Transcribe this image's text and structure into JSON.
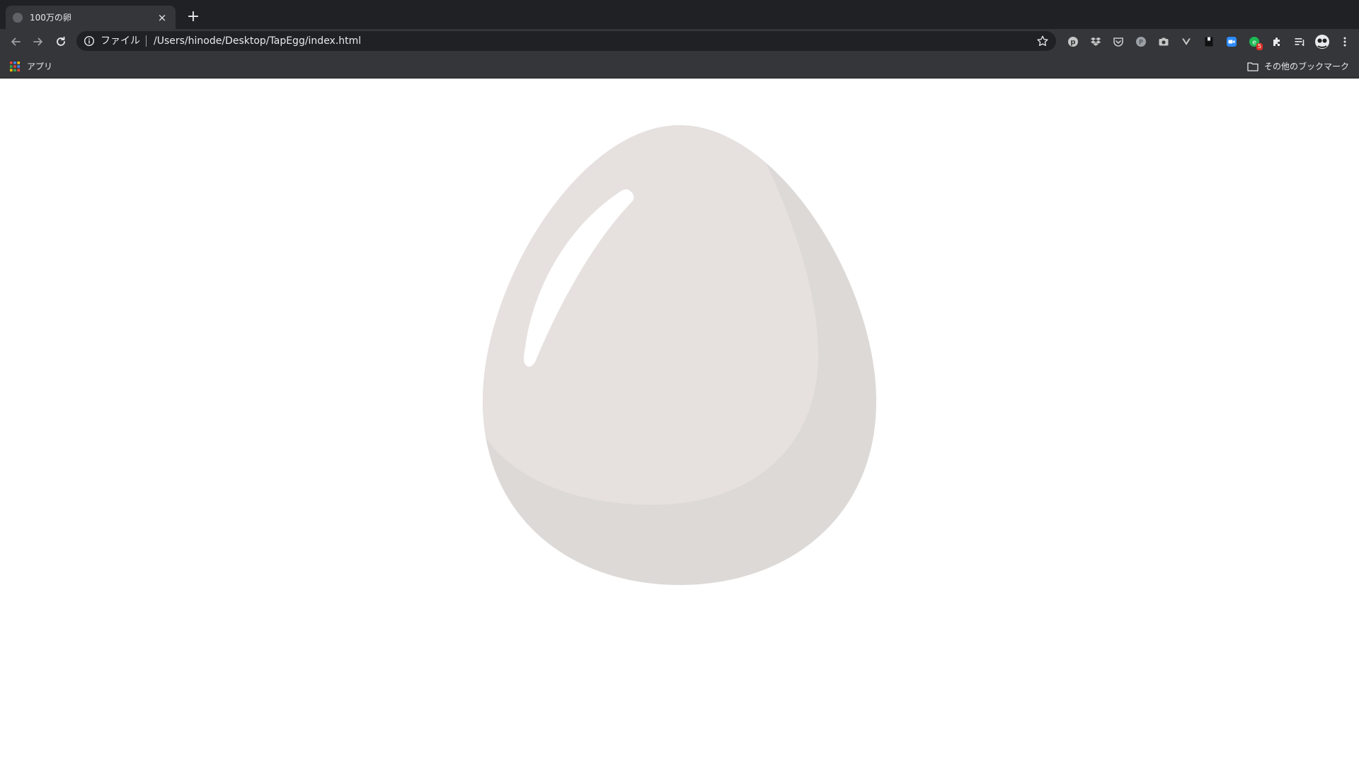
{
  "browser": {
    "tab": {
      "title": "100万の卵",
      "favicon": "globe-icon",
      "close": "×"
    },
    "new_tab": "+",
    "omnibox": {
      "scheme_label": "ファイル",
      "url": "/Users/hinode/Desktop/TapEgg/index.html"
    },
    "extensions": [
      {
        "name": "pinterest-extension-icon"
      },
      {
        "name": "dropbox-extension-icon"
      },
      {
        "name": "pocket-extension-icon"
      },
      {
        "name": "circle-p-extension-icon"
      },
      {
        "name": "camera-extension-icon"
      },
      {
        "name": "vimeo-extension-icon"
      },
      {
        "name": "bookmark-extension-icon"
      },
      {
        "name": "zoom-extension-icon"
      },
      {
        "name": "notification-extension-icon",
        "badge": "5"
      },
      {
        "name": "puzzle-extensions-icon"
      },
      {
        "name": "reading-list-icon"
      },
      {
        "name": "profile-avatar"
      },
      {
        "name": "more-menu-icon"
      }
    ],
    "bookmarks": {
      "apps_label": "アプリ",
      "other_label": "その他のブックマーク"
    }
  },
  "page": {
    "egg": {
      "shell_color": "#e6e1df",
      "shadow_color": "#ddd9d7",
      "highlight_color": "#ffffff"
    }
  }
}
